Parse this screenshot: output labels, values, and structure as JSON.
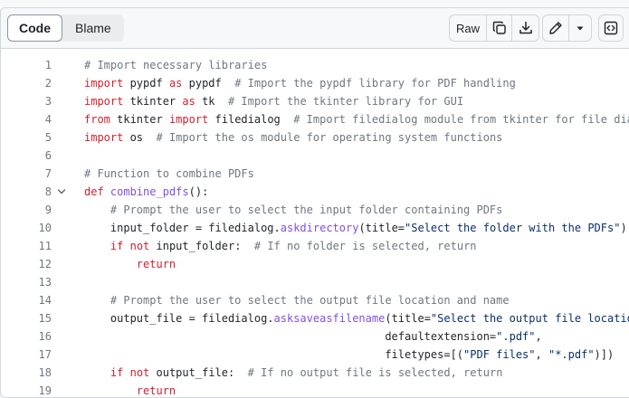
{
  "toolbar": {
    "code_tab": "Code",
    "blame_tab": "Blame",
    "raw_label": "Raw"
  },
  "icons": {
    "copy": "copy-icon",
    "download": "download-icon",
    "edit": "pencil-icon",
    "more": "triangle-down-icon",
    "symbols": "code-square-icon",
    "fold": "chevron-down-icon"
  },
  "colors": {
    "keyword": "#cf222e",
    "comment": "#6e7781",
    "function": "#8250df",
    "string": "#0a3069"
  },
  "lines": [
    {
      "n": "1",
      "tokens": [
        {
          "t": "# Import necessary libraries",
          "c": "cm"
        }
      ]
    },
    {
      "n": "2",
      "tokens": [
        {
          "t": "import",
          "c": "kw"
        },
        {
          "t": " pypdf ",
          "c": "pn"
        },
        {
          "t": "as",
          "c": "kw"
        },
        {
          "t": " pypdf  ",
          "c": "pn"
        },
        {
          "t": "# Import the pypdf library for PDF handling",
          "c": "cm"
        }
      ]
    },
    {
      "n": "3",
      "tokens": [
        {
          "t": "import",
          "c": "kw"
        },
        {
          "t": " tkinter ",
          "c": "pn"
        },
        {
          "t": "as",
          "c": "kw"
        },
        {
          "t": " tk  ",
          "c": "pn"
        },
        {
          "t": "# Import the tkinter library for GUI",
          "c": "cm"
        }
      ]
    },
    {
      "n": "4",
      "tokens": [
        {
          "t": "from",
          "c": "kw"
        },
        {
          "t": " tkinter ",
          "c": "pn"
        },
        {
          "t": "import",
          "c": "kw"
        },
        {
          "t": " filedialog  ",
          "c": "pn"
        },
        {
          "t": "# Import filedialog module from tkinter for file dia",
          "c": "cm"
        }
      ]
    },
    {
      "n": "5",
      "tokens": [
        {
          "t": "import",
          "c": "kw"
        },
        {
          "t": " os  ",
          "c": "pn"
        },
        {
          "t": "# Import the os module for operating system functions",
          "c": "cm"
        }
      ]
    },
    {
      "n": "6",
      "tokens": []
    },
    {
      "n": "7",
      "tokens": [
        {
          "t": "# Function to combine PDFs",
          "c": "cm"
        }
      ]
    },
    {
      "n": "8",
      "fold": true,
      "tokens": [
        {
          "t": "def",
          "c": "kw"
        },
        {
          "t": " ",
          "c": "pn"
        },
        {
          "t": "combine_pdfs",
          "c": "fn"
        },
        {
          "t": "():",
          "c": "pn"
        }
      ]
    },
    {
      "n": "9",
      "tokens": [
        {
          "t": "    # Prompt the user to select the input folder containing PDFs",
          "c": "cm"
        }
      ]
    },
    {
      "n": "10",
      "tokens": [
        {
          "t": "    input_folder = filedialog.",
          "c": "pn"
        },
        {
          "t": "askdirectory",
          "c": "fn"
        },
        {
          "t": "(title=",
          "c": "pn"
        },
        {
          "t": "\"Select the folder with the PDFs\"",
          "c": "st"
        },
        {
          "t": ")",
          "c": "pn"
        }
      ]
    },
    {
      "n": "11",
      "tokens": [
        {
          "t": "    ",
          "c": "pn"
        },
        {
          "t": "if",
          "c": "kw"
        },
        {
          "t": " ",
          "c": "pn"
        },
        {
          "t": "not",
          "c": "kw"
        },
        {
          "t": " input_folder:  ",
          "c": "pn"
        },
        {
          "t": "# If no folder is selected, return",
          "c": "cm"
        }
      ]
    },
    {
      "n": "12",
      "tokens": [
        {
          "t": "        ",
          "c": "pn"
        },
        {
          "t": "return",
          "c": "kw"
        }
      ]
    },
    {
      "n": "13",
      "tokens": []
    },
    {
      "n": "14",
      "tokens": [
        {
          "t": "    # Prompt the user to select the output file location and name",
          "c": "cm"
        }
      ]
    },
    {
      "n": "15",
      "tokens": [
        {
          "t": "    output_file = filedialog.",
          "c": "pn"
        },
        {
          "t": "asksaveasfilename",
          "c": "fn"
        },
        {
          "t": "(title=",
          "c": "pn"
        },
        {
          "t": "\"Select the output file locatio",
          "c": "st"
        }
      ]
    },
    {
      "n": "16",
      "tokens": [
        {
          "t": "                                              defaultextension=",
          "c": "pn"
        },
        {
          "t": "\".pdf\"",
          "c": "st"
        },
        {
          "t": ",",
          "c": "pn"
        }
      ]
    },
    {
      "n": "17",
      "tokens": [
        {
          "t": "                                              filetypes=[(",
          "c": "pn"
        },
        {
          "t": "\"PDF files\"",
          "c": "st"
        },
        {
          "t": ", ",
          "c": "pn"
        },
        {
          "t": "\"*.pdf\"",
          "c": "st"
        },
        {
          "t": ")])",
          "c": "pn"
        }
      ]
    },
    {
      "n": "18",
      "tokens": [
        {
          "t": "    ",
          "c": "pn"
        },
        {
          "t": "if",
          "c": "kw"
        },
        {
          "t": " ",
          "c": "pn"
        },
        {
          "t": "not",
          "c": "kw"
        },
        {
          "t": " output_file:  ",
          "c": "pn"
        },
        {
          "t": "# If no output file is selected, return",
          "c": "cm"
        }
      ]
    },
    {
      "n": "19",
      "tokens": [
        {
          "t": "        ",
          "c": "pn"
        },
        {
          "t": "return",
          "c": "kw"
        }
      ]
    }
  ]
}
